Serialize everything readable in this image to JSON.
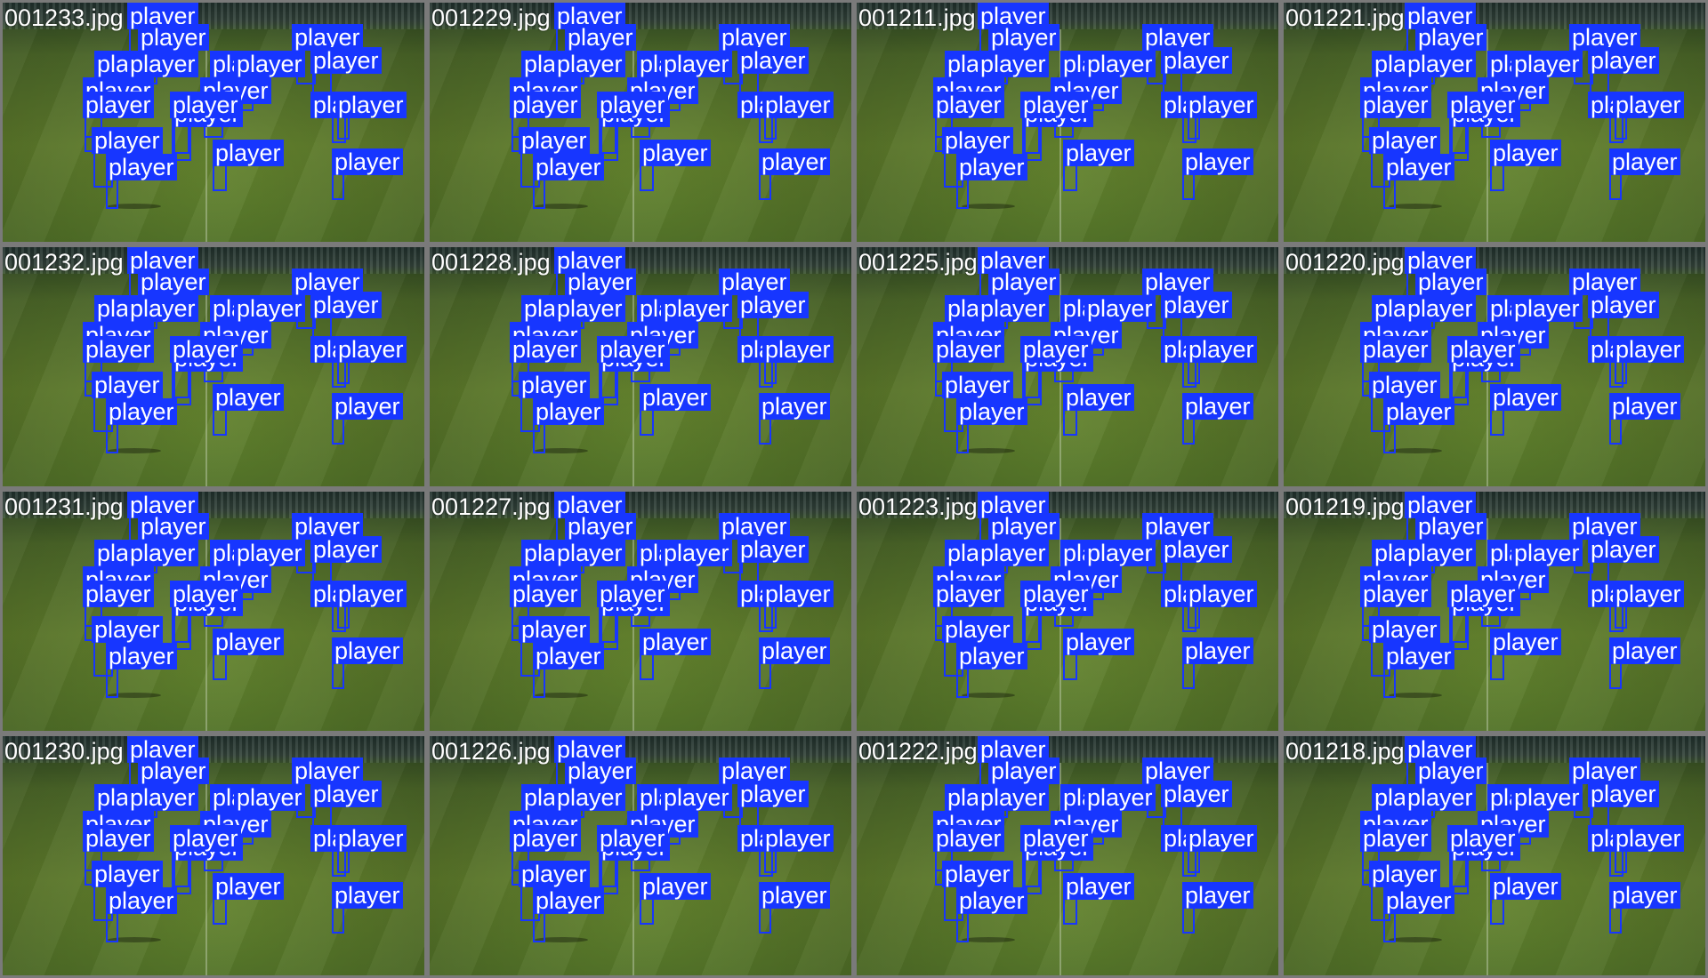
{
  "colors": {
    "box": "#1736ff",
    "label_text": "#ffffff",
    "tile_border": "#7a7a7a",
    "pitch": "#5d7d2e"
  },
  "detection_label": "player",
  "tiles": [
    {
      "filename": "001233.jpg"
    },
    {
      "filename": "001229.jpg"
    },
    {
      "filename": "001211.jpg"
    },
    {
      "filename": "001221.jpg"
    },
    {
      "filename": "001232.jpg"
    },
    {
      "filename": "001228.jpg"
    },
    {
      "filename": "001225.jpg"
    },
    {
      "filename": "001220.jpg"
    },
    {
      "filename": "001231.jpg"
    },
    {
      "filename": "001227.jpg"
    },
    {
      "filename": "001223.jpg"
    },
    {
      "filename": "001219.jpg"
    },
    {
      "filename": "001230.jpg"
    },
    {
      "filename": "001226.jpg"
    },
    {
      "filename": "001222.jpg"
    },
    {
      "filename": "001218.jpg"
    }
  ]
}
